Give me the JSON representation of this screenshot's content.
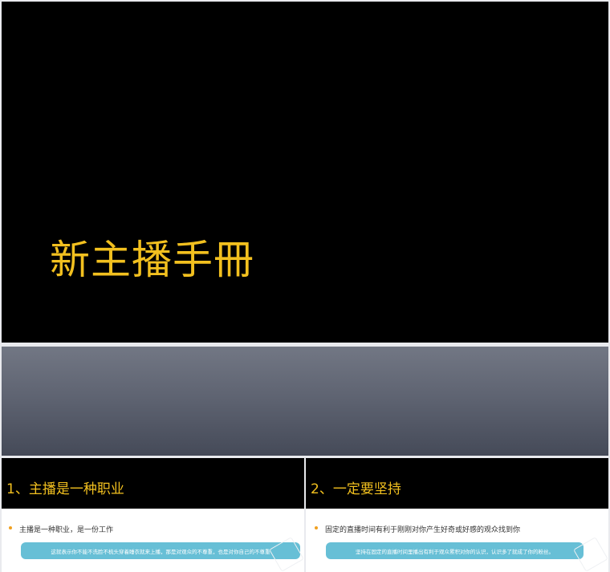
{
  "main_slide": {
    "title": "新主播手冊"
  },
  "slide_1": {
    "heading": "1、主播是一种职业",
    "bullet": "主播是一种职业，是一份工作",
    "note": "这就表示你不能不洗脸不梳头穿着睡衣就来上播，那是对观众的不尊重，也是对你自己的不尊重"
  },
  "slide_2": {
    "heading": "2、一定要坚持",
    "bullet": "固定的直播时间有利于刚刚对你产生好奇或好感的观众找到你",
    "note": "坚持在固定的直播时间里播出有利于观众累积对你的认识，认识多了就成了你的粉丝。"
  },
  "colors": {
    "title_yellow": "#f2c01f",
    "slide_black": "#000000",
    "note_bar": "#67bfd6",
    "bullet": "#f0a020"
  }
}
